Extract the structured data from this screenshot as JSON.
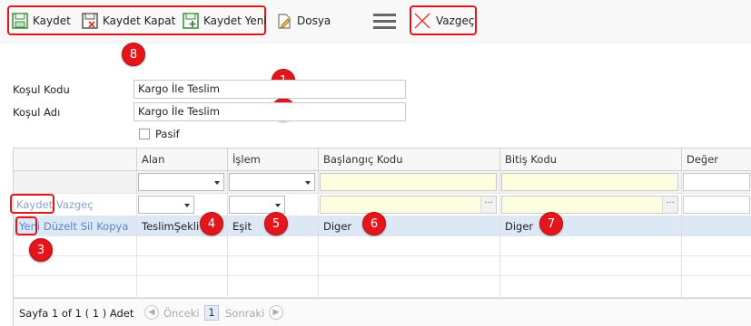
{
  "toolbar": {
    "save_label": "Kaydet",
    "save_close_label": "Kaydet Kapat",
    "save_new_label": "Kaydet Yeni",
    "file_label": "Dosya",
    "cancel_label": "Vazgeç"
  },
  "badges": [
    "1",
    "2",
    "3",
    "4",
    "5",
    "6",
    "7",
    "8"
  ],
  "form": {
    "code_label": "Koşul Kodu",
    "code_value": "Kargo İle Teslim",
    "name_label": "Koşul Adı",
    "name_value": "Kargo İle Teslim",
    "passive_label": "Pasif"
  },
  "grid": {
    "columns": [
      "Alan",
      "İşlem",
      "Başlangıç Kodu",
      "Bitiş Kodu",
      "Değer"
    ],
    "edit_actions": {
      "save": "Kaydet",
      "cancel": "Vazgeç"
    },
    "row_actions": {
      "new": "Yeni",
      "edit": "Düzelt",
      "delete": "Sil",
      "copy": "Kopya"
    },
    "rows": [
      {
        "alan": "TeslimŞekli",
        "islem": "Eşit",
        "baslangic": "Diger",
        "bitis": "Diger",
        "deger": ""
      }
    ]
  },
  "pager": {
    "summary": "Sayfa 1 of 1 ( 1 ) Adet",
    "prev": "Önceki",
    "page": "1",
    "next": "Sonraki"
  },
  "colors": {
    "highlight": "#e4141b",
    "link": "#5b84c4",
    "selected_row": "#dde8f7",
    "filter_yellow": "#fdfde0"
  }
}
